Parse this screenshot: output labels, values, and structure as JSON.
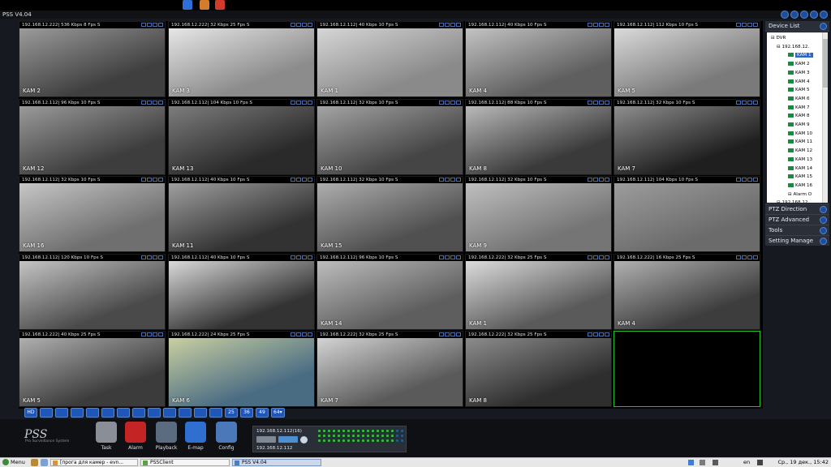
{
  "window": {
    "title": "PSS  V4.04"
  },
  "cameras": [
    {
      "header": "192.168.12.222| 536 Kbps 8 Fps S",
      "label": "KAM 2",
      "shade": [
        "#3f3f3f",
        "#9b9b9b"
      ]
    },
    {
      "header": "192.168.12.222| 32 Kbps 25 Fps S",
      "label": "KAM 3",
      "shade": [
        "#8c8c8c",
        "#e6e6e6"
      ]
    },
    {
      "header": "192.168.12.112| 40 Kbps 10 Fps S",
      "label": "KAM 1",
      "shade": [
        "#8a8a8a",
        "#d6d6d6"
      ]
    },
    {
      "header": "192.168.12.112| 40 Kbps 10 Fps S",
      "label": "KAM 4",
      "shade": [
        "#5f5f5f",
        "#c3c3c3"
      ]
    },
    {
      "header": "192.168.12.112| 112 Kbps 10 Fps S",
      "label": "KAM 5",
      "shade": [
        "#7a7a7a",
        "#dadada"
      ]
    },
    {
      "header": "192.168.12.112| 96 Kbps 10 Fps S",
      "label": "KAM 12",
      "shade": [
        "#3d3d3d",
        "#9a9a9a"
      ]
    },
    {
      "header": "192.168.12.112| 104 Kbps 10 Fps S",
      "label": "KAM 13",
      "shade": [
        "#2a2a2a",
        "#7d7d7d"
      ]
    },
    {
      "header": "192.168.12.112| 32 Kbps 10 Fps S",
      "label": "KAM 10",
      "shade": [
        "#454545",
        "#a4a4a4"
      ]
    },
    {
      "header": "192.168.12.112| 88 Kbps 10 Fps S",
      "label": "KAM 8",
      "shade": [
        "#3a3a3a",
        "#b9b9b9"
      ]
    },
    {
      "header": "192.168.12.112| 32 Kbps 10 Fps S",
      "label": "KAM 7",
      "shade": [
        "#1f1f1f",
        "#8e8e8e"
      ]
    },
    {
      "header": "192.168.12.112| 32 Kbps 10 Fps S",
      "label": "KAM 16",
      "shade": [
        "#6f6f6f",
        "#c6c6c6"
      ]
    },
    {
      "header": "192.168.12.112| 40 Kbps 10 Fps S",
      "label": "KAM 11",
      "shade": [
        "#323232",
        "#9f9f9f"
      ]
    },
    {
      "header": "192.168.12.112| 32 Kbps 10 Fps S",
      "label": "KAM 15",
      "shade": [
        "#505050",
        "#aeaeae"
      ]
    },
    {
      "header": "192.168.12.112| 32 Kbps 10 Fps S",
      "label": "KAM 9",
      "shade": [
        "#757575",
        "#bfbfbf"
      ]
    },
    {
      "header": "192.168.12.112| 104 Kbps 10 Fps S",
      "label": "",
      "shade": [
        "#6b6b6b",
        "#9c9c9c"
      ]
    },
    {
      "header": "192.168.12.112| 120 Kbps 10 Fps S",
      "label": "",
      "shade": [
        "#4a4a4a",
        "#c4c4c4"
      ]
    },
    {
      "header": "192.168.12.112| 40 Kbps 10 Fps S",
      "label": "",
      "shade": [
        "#333333",
        "#d9d9d9"
      ]
    },
    {
      "header": "192.168.12.112| 96 Kbps 10 Fps S",
      "label": "KAM 14",
      "shade": [
        "#5e5e5e",
        "#bdbdbd"
      ]
    },
    {
      "header": "192.168.12.222| 32 Kbps 25 Fps S",
      "label": "KAM 1",
      "shade": [
        "#5a5a5a",
        "#dcdcdc"
      ]
    },
    {
      "header": "192.168.12.222| 16 Kbps 25 Fps S",
      "label": "KAM 4",
      "shade": [
        "#3d3d3d",
        "#b1b1b1"
      ]
    },
    {
      "header": "192.168.12.222| 40 Kbps 25 Fps S",
      "label": "KAM 5",
      "shade": [
        "#3b3b3b",
        "#b0b0b0"
      ]
    },
    {
      "header": "192.168.12.222| 24 Kbps 25 Fps S",
      "label": "KAM 6",
      "shade": [
        "#4a6c83",
        "#c9cfa1"
      ]
    },
    {
      "header": "192.168.12.222| 32 Kbps 25 Fps S",
      "label": "KAM 7",
      "shade": [
        "#5a5a5a",
        "#d4d4d4"
      ]
    },
    {
      "header": "192.168.12.222| 32 Kbps 25 Fps S",
      "label": "KAM 8",
      "shade": [
        "#2e2e2e",
        "#8c8c8c"
      ]
    },
    {
      "header": "",
      "label": "",
      "shade": [
        "#000000",
        "#000000"
      ]
    }
  ],
  "toolbar": {
    "buttons": [
      "HD",
      "",
      "",
      "",
      "",
      "",
      "",
      "",
      "",
      "",
      "",
      "",
      "",
      "25",
      "36",
      "49",
      "64▾"
    ]
  },
  "right_panel": {
    "device_list_title": "Device List",
    "tree": {
      "root": "DVR",
      "host1": "192.168.12.",
      "cams": [
        "KAM 1",
        "KAM 2",
        "KAM 3",
        "KAM 4",
        "KAM 5",
        "KAM 6",
        "KAM 7",
        "KAM 8",
        "KAM 9",
        "KAM 10",
        "KAM 11",
        "KAM 12",
        "KAM 13",
        "KAM 14",
        "KAM 15",
        "KAM 16"
      ],
      "alarm": "Alarm O",
      "host2": "192.168.12."
    },
    "sections": [
      "PTZ Direction",
      "PTZ Advanced",
      "Tools",
      "Setting Manage"
    ]
  },
  "logo": {
    "text": "PSS",
    "subtitle": "Pro Surveillance System"
  },
  "main_buttons": [
    {
      "label": "Task",
      "color": "#8a8f97"
    },
    {
      "label": "Alarm",
      "color": "#c42424"
    },
    {
      "label": "Playback",
      "color": "#5c6c80"
    },
    {
      "label": "E-map",
      "color": "#2f6fd0"
    },
    {
      "label": "Config",
      "color": "#4a78b8"
    }
  ],
  "status": {
    "ip_top": "192.168.12.112(16)",
    "ip_bottom": "192.168.12.112"
  },
  "taskbar": {
    "menu": "Menu",
    "items": [
      "[прога для камер - evn...",
      "PSSClient",
      "PSS  V4.04"
    ],
    "lang": "en",
    "clock": "Ср., 19 дек., 15:42"
  }
}
